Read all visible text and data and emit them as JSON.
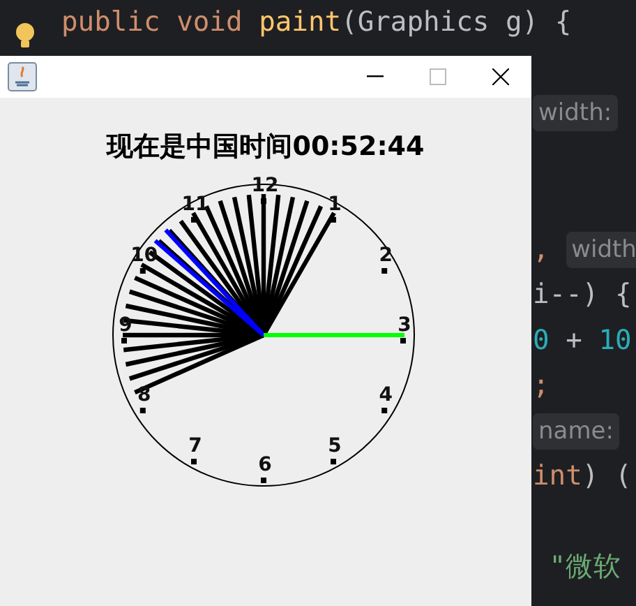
{
  "editor": {
    "lines": [
      {
        "kind": "full",
        "tokens": [
          {
            "kind": "keyword",
            "text": "public void "
          },
          {
            "kind": "method",
            "text": "paint"
          },
          {
            "kind": "plain",
            "text": "(Graphics g) {"
          }
        ]
      },
      {
        "kind": "blank"
      },
      {
        "kind": "partial",
        "tokens": [
          {
            "kind": "hint",
            "text": "width:"
          }
        ]
      },
      {
        "kind": "blank"
      },
      {
        "kind": "blank"
      },
      {
        "kind": "partial",
        "tokens": [
          {
            "kind": "keyword",
            "text": ", "
          },
          {
            "kind": "hint",
            "text": "width"
          }
        ]
      },
      {
        "kind": "partial",
        "tokens": [
          {
            "kind": "plain",
            "text": "i--) {"
          }
        ]
      },
      {
        "kind": "partial",
        "tokens": [
          {
            "kind": "number",
            "text": "0"
          },
          {
            "kind": "plain",
            "text": " + "
          },
          {
            "kind": "number",
            "text": "10"
          }
        ]
      },
      {
        "kind": "partial",
        "tokens": [
          {
            "kind": "keyword",
            "text": ";"
          }
        ]
      },
      {
        "kind": "partial",
        "tokens": [
          {
            "kind": "hint",
            "text": "name:"
          }
        ]
      },
      {
        "kind": "partial",
        "tokens": [
          {
            "kind": "keyword",
            "text": "int"
          },
          {
            "kind": "plain",
            "text": ") ("
          }
        ]
      },
      {
        "kind": "blank"
      },
      {
        "kind": "partial",
        "tokens": [
          {
            "kind": "string",
            "text": " \"微软"
          }
        ]
      }
    ]
  },
  "window": {
    "heading": "现在是中国时间00:52:44",
    "clock": {
      "numerals": [
        "12",
        "1",
        "2",
        "3",
        "4",
        "5",
        "6",
        "7",
        "8",
        "9",
        "10",
        "11"
      ]
    }
  }
}
